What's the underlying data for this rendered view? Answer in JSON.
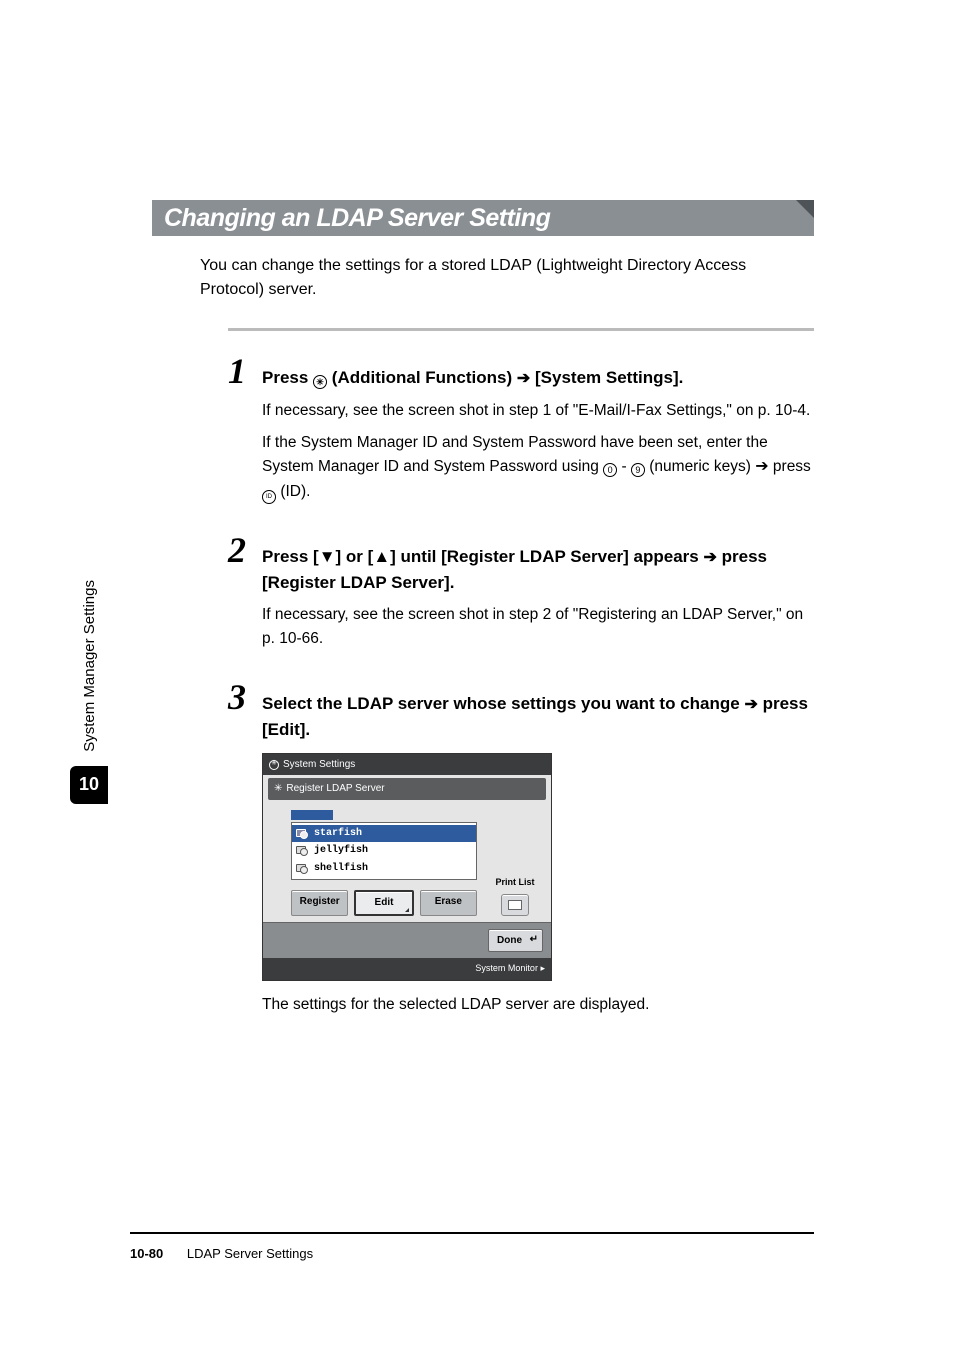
{
  "heading": "Changing an LDAP Server Setting",
  "intro": "You can change the settings for a stored LDAP (Lightweight Directory Access Protocol) server.",
  "steps": {
    "s1": {
      "num": "1",
      "title_before": "Press ",
      "title_mid": " (Additional Functions) ",
      "title_after": " [System Settings].",
      "p1": "If necessary, see the screen shot in step 1 of \"E-Mail/I-Fax Settings,\" on p. 10-4.",
      "p2a": "If the System Manager ID and System Password have been set, enter the System Manager ID and System Password using ",
      "p2b": " - ",
      "p2c": " (numeric keys) ",
      "p2d": " press ",
      "p2e": " (ID)."
    },
    "s2": {
      "num": "2",
      "title_a": "Press [",
      "title_b": "] or [",
      "title_c": "] until [Register LDAP Server] appears ",
      "title_d": " press [Register LDAP Server].",
      "p1": "If necessary, see the screen shot in step 2 of \"Registering an LDAP Server,\" on p. 10-66."
    },
    "s3": {
      "num": "3",
      "title_a": "Select the LDAP server whose settings you want to change ",
      "title_b": " press [Edit].",
      "p1": "The settings for the selected LDAP server are displayed."
    }
  },
  "screenshot": {
    "system_settings": "System Settings",
    "register_ldap": "Register LDAP Server",
    "servers": [
      "starfish",
      "jellyfish",
      "shellfish"
    ],
    "btn_register": "Register",
    "btn_edit": "Edit",
    "btn_erase": "Erase",
    "print_list": "Print List",
    "done": "Done",
    "system_monitor": "System Monitor"
  },
  "glyphs": {
    "down_triangle": "▼",
    "up_triangle": "▲",
    "right_arrow": "➔",
    "circled_star": "✳",
    "zero": "0",
    "nine": "9",
    "id": "ID"
  },
  "sidebar": {
    "label": "System Manager Settings",
    "chapter": "10"
  },
  "footer": {
    "page": "10-80",
    "title": "LDAP Server Settings"
  }
}
